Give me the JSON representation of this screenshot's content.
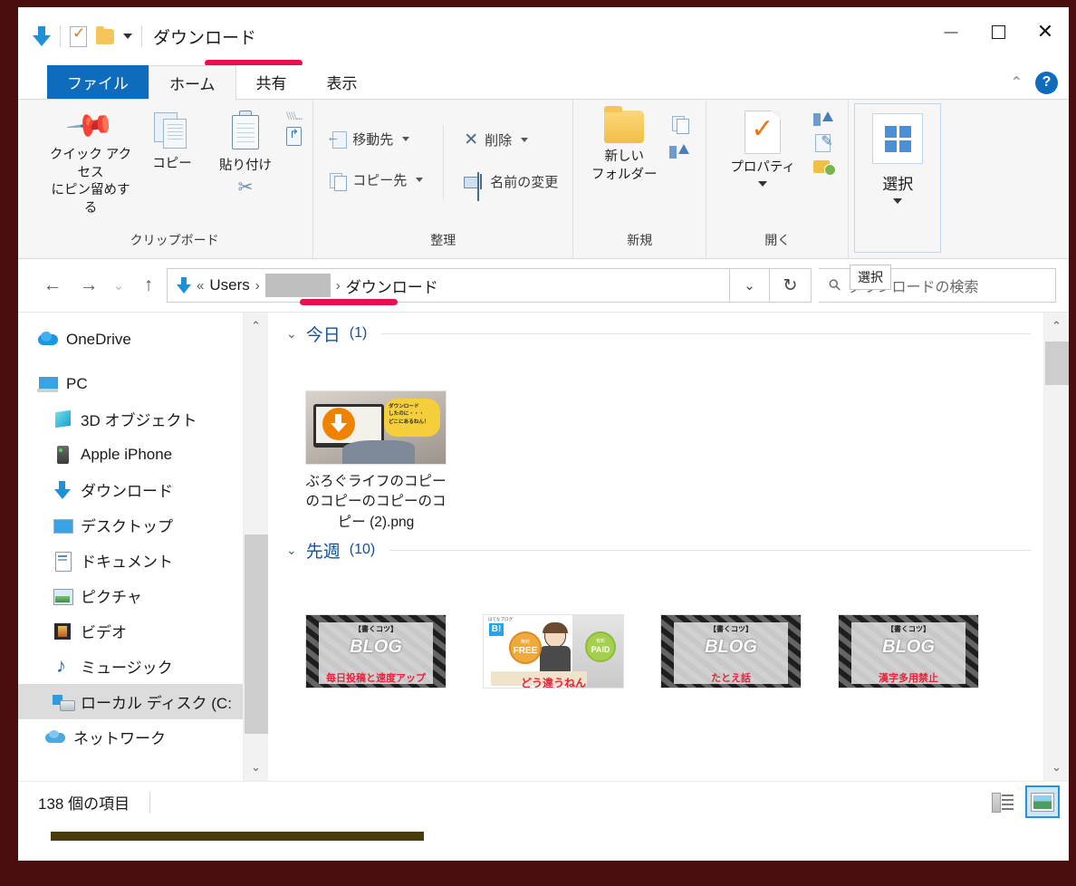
{
  "window": {
    "title": "ダウンロード",
    "quick_access_icons": [
      "download-arrow-icon",
      "properties-icon",
      "folder-icon",
      "customize-caret-icon"
    ],
    "controls": {
      "minimize": "—",
      "maximize": "□",
      "close": "✕"
    }
  },
  "ribbon": {
    "tabs": [
      {
        "label": "ファイル",
        "state": "file"
      },
      {
        "label": "ホーム",
        "state": "active"
      },
      {
        "label": "共有",
        "state": "normal"
      },
      {
        "label": "表示",
        "state": "normal"
      }
    ],
    "collapse_label": "⌃",
    "help_label": "?",
    "groups": [
      {
        "name": "clipboard",
        "label": "クリップボード",
        "buttons": [
          {
            "label": "クイック アクセス\nにピン留めする",
            "label_line1": "クイック アクセス",
            "label_line2": "にピン留めする",
            "icon": "pin-icon"
          },
          {
            "label": "コピー",
            "icon": "copy-icon"
          },
          {
            "label": "貼り付け",
            "icon": "paste-icon"
          }
        ],
        "small_items": [
          {
            "label": "パスのコピー",
            "icon": "copy-path-icon"
          },
          {
            "label": "ショートカットの貼り付け",
            "icon": "paste-shortcut-icon"
          },
          {
            "label": "切り取り",
            "icon": "cut-scissors-icon"
          }
        ]
      },
      {
        "name": "organize",
        "label": "整理",
        "items": [
          {
            "label": "移動先",
            "icon": "move-to-icon",
            "has_dropdown": true
          },
          {
            "label": "コピー先",
            "icon": "copy-to-icon",
            "has_dropdown": true
          },
          {
            "label": "削除",
            "icon": "delete-x-icon",
            "has_dropdown": true
          },
          {
            "label": "名前の変更",
            "icon": "rename-icon",
            "has_dropdown": false
          }
        ]
      },
      {
        "name": "new",
        "label": "新規",
        "buttons": [
          {
            "label_line1": "新しい",
            "label_line2": "フォルダー",
            "icon": "new-folder-icon"
          }
        ],
        "small_items": [
          {
            "label": "新しいアイテム",
            "icon": "new-item-icon",
            "has_dropdown": true
          },
          {
            "label": "ショートカット",
            "icon": "shortcut-icon",
            "has_dropdown": true
          }
        ]
      },
      {
        "name": "open",
        "label": "開く",
        "buttons": [
          {
            "label": "プロパティ",
            "icon": "properties-check-icon",
            "has_dropdown": true
          }
        ],
        "small_items": [
          {
            "label": "開く",
            "icon": "open-icon",
            "has_dropdown": true
          },
          {
            "label": "編集",
            "icon": "edit-icon"
          },
          {
            "label": "履歴",
            "icon": "history-icon"
          }
        ]
      },
      {
        "name": "select",
        "label": "選択",
        "buttons": [
          {
            "label": "選択",
            "icon": "select-grid-icon",
            "has_dropdown": true
          }
        ]
      }
    ]
  },
  "address_bar": {
    "back_icon": "←",
    "forward_icon": "→",
    "recent_icon": "⌄",
    "up_icon": "↑",
    "breadcrumb": [
      {
        "label": "Users",
        "type": "text"
      },
      {
        "label": "",
        "type": "redacted"
      },
      {
        "label": "ダウンロード",
        "type": "text",
        "current": true
      }
    ],
    "overflow_chevron": "«",
    "separator": "›",
    "dropdown_icon": "⌄",
    "refresh_icon": "↻",
    "search_placeholder": "ダウンロードの検索",
    "search_value": "",
    "search_icon": "search-icon"
  },
  "tooltip": {
    "text": "選択"
  },
  "nav_pane": {
    "items": [
      {
        "label": "OneDrive",
        "icon": "onedrive-icon",
        "indent": 0,
        "selected": false
      },
      {
        "label": "PC",
        "icon": "pc-icon",
        "indent": 0,
        "selected": false
      },
      {
        "label": "3D オブジェクト",
        "icon": "3d-objects-icon",
        "indent": 1,
        "selected": false
      },
      {
        "label": "Apple iPhone",
        "icon": "iphone-icon",
        "indent": 1,
        "selected": false
      },
      {
        "label": "ダウンロード",
        "icon": "downloads-icon",
        "indent": 1,
        "selected": false
      },
      {
        "label": "デスクトップ",
        "icon": "desktop-icon",
        "indent": 1,
        "selected": false
      },
      {
        "label": "ドキュメント",
        "icon": "documents-icon",
        "indent": 1,
        "selected": false
      },
      {
        "label": "ピクチャ",
        "icon": "pictures-icon",
        "indent": 1,
        "selected": false
      },
      {
        "label": "ビデオ",
        "icon": "videos-icon",
        "indent": 1,
        "selected": false
      },
      {
        "label": "ミュージック",
        "icon": "music-icon",
        "indent": 1,
        "selected": false
      },
      {
        "label": "ローカル ディスク (C:",
        "icon": "local-disk-icon",
        "indent": 1,
        "selected": true
      },
      {
        "label": "ネットワーク",
        "icon": "network-icon",
        "indent": 0,
        "selected": false
      }
    ]
  },
  "file_list": {
    "groups": [
      {
        "name": "今日",
        "count": "(1)",
        "chevron": "⌄",
        "files": [
          {
            "name": "ぶろぐライフのコピーのコピーのコピーのコピー (2).png",
            "thumb": "download-laptop-thumb"
          }
        ]
      },
      {
        "name": "先週",
        "count": "(10)",
        "chevron": "⌄",
        "files": [
          {
            "name": "",
            "thumb": "blog-daily-thumb",
            "caption": "毎日投稿と速度アップ",
            "tag": "【書くコツ】",
            "logo": "BLOG"
          },
          {
            "name": "",
            "thumb": "free-paid-thumb",
            "caption": "どう違うねん",
            "badge_left": "FREE",
            "badge_left_sub": "無料",
            "badge_right": "PAID",
            "badge_right_sub": "有料",
            "brand": "B!",
            "brand_label": "はてなブログ"
          },
          {
            "name": "",
            "thumb": "blog-example-thumb",
            "caption": "たとえ話",
            "tag": "【書くコツ】",
            "logo": "BLOG"
          },
          {
            "name": "",
            "thumb": "blog-kanji-thumb",
            "caption": "漢字多用禁止",
            "tag": "【書くコツ】",
            "logo": "BLOG"
          }
        ]
      }
    ]
  },
  "status_bar": {
    "item_count": "138 個の項目",
    "view_buttons": [
      {
        "name": "details-view",
        "icon": "details-view-icon",
        "active": false
      },
      {
        "name": "large-icons-view",
        "icon": "large-icons-view-icon",
        "active": true
      }
    ]
  },
  "annotations": {
    "underline_color": "#e81150",
    "border_color": "#4a0e0e"
  }
}
